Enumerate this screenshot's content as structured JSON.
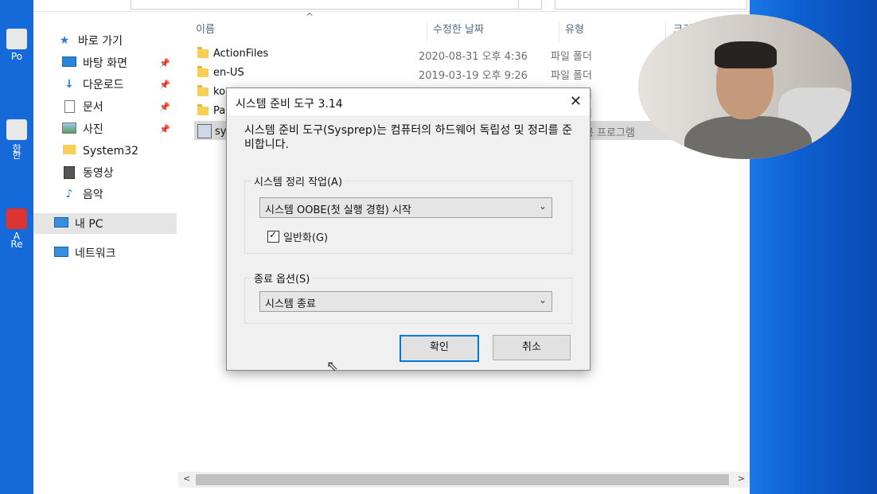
{
  "desktop": {
    "icon_labels": [
      "Po",
      "한",
      "한",
      "A",
      "Re"
    ]
  },
  "explorer": {
    "nav": {
      "quick_access": "바로 가기",
      "items": [
        {
          "label": "바탕 화면",
          "icon": "desktop-icon",
          "pinned": true
        },
        {
          "label": "다운로드",
          "icon": "download-icon",
          "pinned": true
        },
        {
          "label": "문서",
          "icon": "document-icon",
          "pinned": true
        },
        {
          "label": "사진",
          "icon": "picture-icon",
          "pinned": true
        },
        {
          "label": "System32",
          "icon": "folder-icon",
          "pinned": false
        },
        {
          "label": "동영상",
          "icon": "video-icon",
          "pinned": false
        },
        {
          "label": "음악",
          "icon": "music-icon",
          "pinned": false
        }
      ],
      "this_pc": "내 PC",
      "network": "네트워크"
    },
    "columns": {
      "name": "이름",
      "date": "수정한 날짜",
      "type": "유형",
      "size": "크기"
    },
    "files": [
      {
        "name": "ActionFiles",
        "date": "2020-08-31 오후 4:36",
        "type": "파일 폴더"
      },
      {
        "name": "en-US",
        "date": "2019-03-19 오후 9:26",
        "type": "파일 폴더"
      },
      {
        "name": "ko",
        "date": "",
        "type": "파일 폴더"
      },
      {
        "name": "Pa",
        "date": "",
        "type": "파일 폴더"
      },
      {
        "name": "sys",
        "date": "",
        "type": "응용 프로그램"
      }
    ]
  },
  "dialog": {
    "title": "시스템 준비 도구 3.14",
    "description": "시스템 준비 도구(Sysprep)는 컴퓨터의 하드웨어 독립성 및 정리를 준비합니다.",
    "cleanup_group": "시스템 정리 작업(A)",
    "cleanup_value": "시스템 OOBE(첫 실행 경험) 시작",
    "generalize_label": "일반화(G)",
    "generalize_checked": true,
    "shutdown_group": "종료 옵션(S)",
    "shutdown_value": "시스템 종료",
    "ok": "확인",
    "cancel": "취소"
  }
}
